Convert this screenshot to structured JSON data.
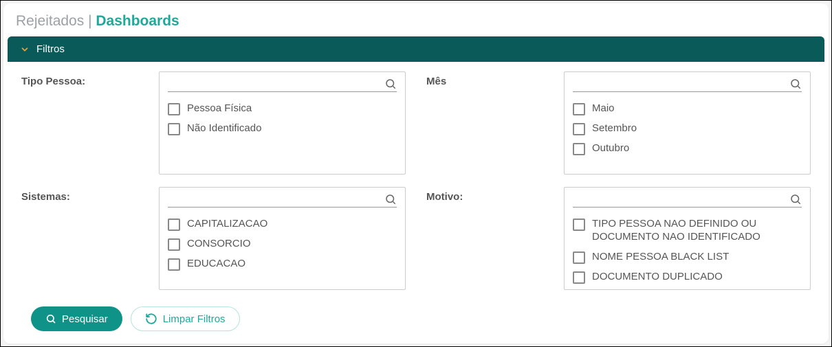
{
  "header": {
    "breadcrumb_inactive": "Rejeitados",
    "breadcrumb_sep": " | ",
    "breadcrumb_active": "Dashboards"
  },
  "filters_bar": {
    "title": "Filtros"
  },
  "filters": {
    "tipo_pessoa": {
      "label": "Tipo Pessoa:",
      "search_placeholder": "",
      "options": [
        "Pessoa Física",
        "Não Identificado"
      ]
    },
    "mes": {
      "label": "Mês",
      "search_placeholder": "",
      "options": [
        "Maio",
        "Setembro",
        "Outubro"
      ]
    },
    "sistemas": {
      "label": "Sistemas:",
      "search_placeholder": "",
      "options": [
        "CAPITALIZACAO",
        "CONSORCIO",
        "EDUCACAO"
      ]
    },
    "motivo": {
      "label": "Motivo:",
      "search_placeholder": "",
      "options": [
        "TIPO PESSOA NAO DEFINIDO OU DOCUMENTO NAO IDENTIFICADO",
        "NOME PESSOA BLACK LIST",
        "DOCUMENTO DUPLICADO"
      ]
    }
  },
  "actions": {
    "search": "Pesquisar",
    "clear": "Limpar Filtros"
  },
  "colors": {
    "teal_dark": "#0b5a5a",
    "teal": "#1fa99b",
    "teal_btn": "#0f9389"
  }
}
